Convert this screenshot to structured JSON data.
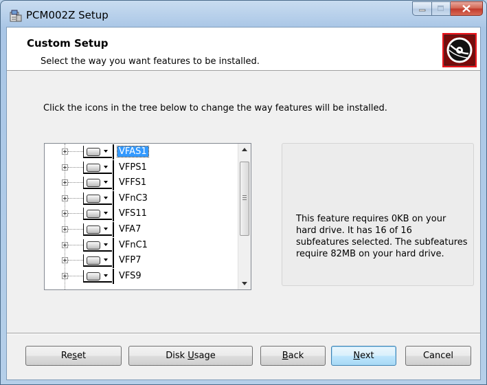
{
  "window": {
    "title": "PCM002Z Setup"
  },
  "banner": {
    "title": "Custom Setup",
    "subtitle": "Select the way you want features to be installed."
  },
  "instruction": "Click the icons in the tree below to change the way features will be installed.",
  "tree": {
    "items": [
      {
        "label": "VFAS1",
        "selected": true
      },
      {
        "label": "VFPS1",
        "selected": false
      },
      {
        "label": "VFFS1",
        "selected": false
      },
      {
        "label": "VFnC3",
        "selected": false
      },
      {
        "label": "VFS11",
        "selected": false
      },
      {
        "label": "VFA7",
        "selected": false
      },
      {
        "label": "VFnC1",
        "selected": false
      },
      {
        "label": "VFP7",
        "selected": false
      },
      {
        "label": "VFS9",
        "selected": false
      }
    ]
  },
  "description": "This feature requires 0KB on your hard drive. It has 16 of 16 subfeatures selected. The subfeatures require 82MB on your hard drive.",
  "buttons": {
    "reset": {
      "pre": "Re",
      "key": "s",
      "post": "et"
    },
    "disk_usage": {
      "pre": "Disk ",
      "key": "U",
      "post": "sage"
    },
    "back": {
      "pre": "",
      "key": "B",
      "post": "ack"
    },
    "next": {
      "pre": "",
      "key": "N",
      "post": "ext"
    },
    "cancel": {
      "label": "Cancel"
    }
  },
  "colors": {
    "selection": "#3399ff",
    "logo_red": "#e8141b"
  }
}
